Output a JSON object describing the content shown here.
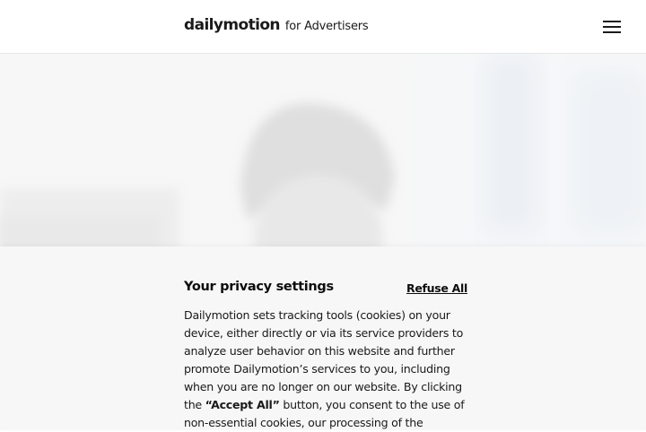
{
  "header": {
    "logo_brand": "dailymotion",
    "logo_suffix": "for Advertisers",
    "menu_icon": "hamburger-menu-icon"
  },
  "hero": {
    "image": "blurred-photo-person-in-beanie"
  },
  "privacy": {
    "title": "Your privacy settings",
    "refuse_all_label": "Refuse All",
    "body_lines": [
      "Dailymotion sets tracking tools (cookies) on your",
      "device, either directly or via its service providers to",
      "analyze user behavior on this website and further",
      "promote Dailymotion’s services to you, including",
      "when you are no longer on our website. By clicking"
    ],
    "line6_prefix": "the ",
    "line6_bold": "“Accept All”",
    "line6_suffix": " button, you consent to the use of",
    "line7": "non-essential cookies, our processing of the"
  }
}
